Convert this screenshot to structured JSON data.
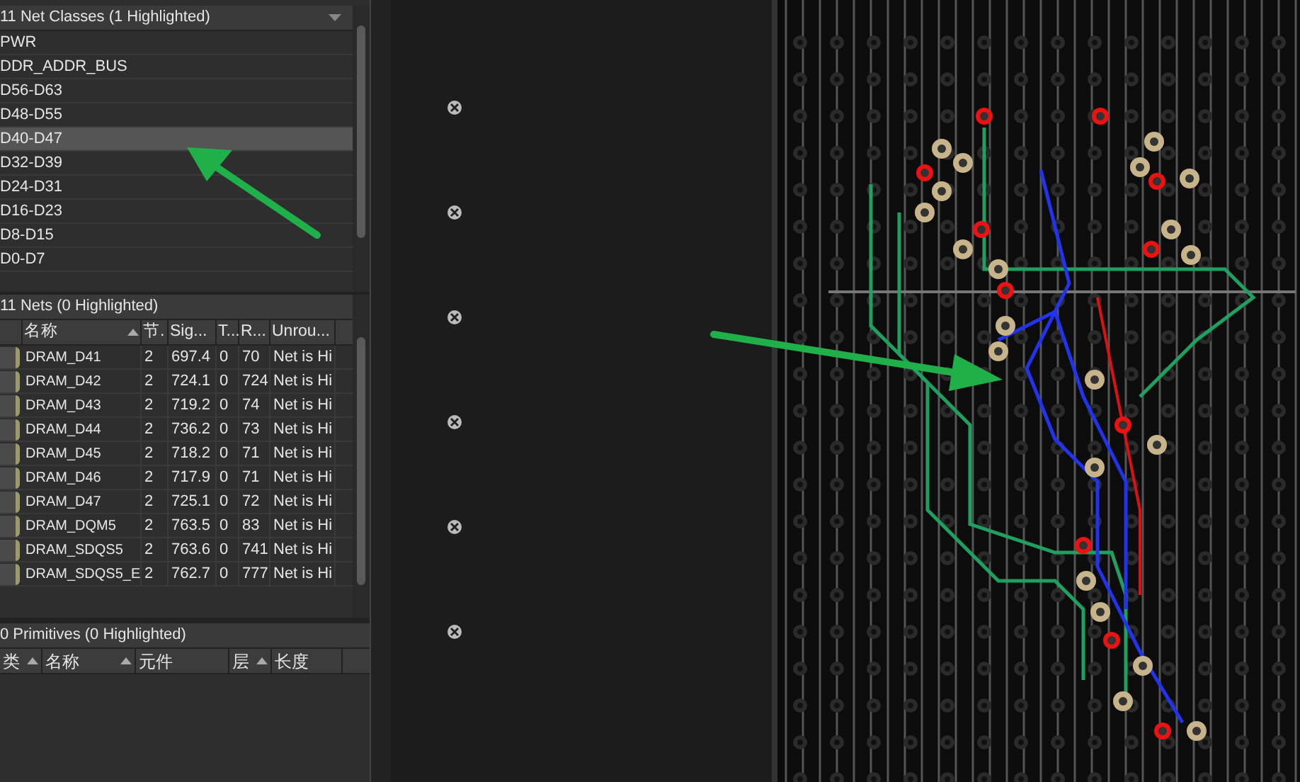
{
  "net_classes": {
    "title": "11 Net Classes (1 Highlighted)",
    "items": [
      {
        "label": "PWR",
        "selected": false
      },
      {
        "label": "DDR_ADDR_BUS",
        "selected": false
      },
      {
        "label": "D56-D63",
        "selected": false
      },
      {
        "label": "D48-D55",
        "selected": false
      },
      {
        "label": "D40-D47",
        "selected": true
      },
      {
        "label": "D32-D39",
        "selected": false
      },
      {
        "label": "D24-D31",
        "selected": false
      },
      {
        "label": "D16-D23",
        "selected": false
      },
      {
        "label": "D8-D15",
        "selected": false
      },
      {
        "label": "D0-D7",
        "selected": false
      }
    ]
  },
  "nets": {
    "title": "11 Nets (0 Highlighted)",
    "columns": [
      "名称",
      "节.",
      "Sig...",
      "T...",
      "R...",
      "Unrou..."
    ],
    "rows": [
      [
        "DRAM_D41",
        "2",
        "697.4",
        "0",
        "70",
        "Net is Hi"
      ],
      [
        "DRAM_D42",
        "2",
        "724.1",
        "0",
        "724",
        "Net is Hi"
      ],
      [
        "DRAM_D43",
        "2",
        "719.2",
        "0",
        "74",
        "Net is Hi"
      ],
      [
        "DRAM_D44",
        "2",
        "736.2",
        "0",
        "73",
        "Net is Hi"
      ],
      [
        "DRAM_D45",
        "2",
        "718.2",
        "0",
        "71",
        "Net is Hi"
      ],
      [
        "DRAM_D46",
        "2",
        "717.9",
        "0",
        "71",
        "Net is Hi"
      ],
      [
        "DRAM_D47",
        "2",
        "725.1",
        "0",
        "72",
        "Net is Hi"
      ],
      [
        "DRAM_DQM5",
        "2",
        "763.5",
        "0",
        "83",
        "Net is Hi"
      ],
      [
        "DRAM_SDQS5",
        "2",
        "763.6",
        "0",
        "741",
        "Net is Hi"
      ],
      [
        "DRAM_SDQS5_E",
        "2",
        "762.7",
        "0",
        "777",
        "Net is Hi"
      ]
    ]
  },
  "primitives": {
    "title": "0 Primitives (0 Highlighted)",
    "columns": [
      {
        "label": "类",
        "sorted": true
      },
      {
        "label": "名称",
        "sorted": true
      },
      {
        "label": "元件",
        "sorted": false
      },
      {
        "label": "层",
        "sorted": true
      },
      {
        "label": "长度",
        "sorted": false
      }
    ]
  }
}
